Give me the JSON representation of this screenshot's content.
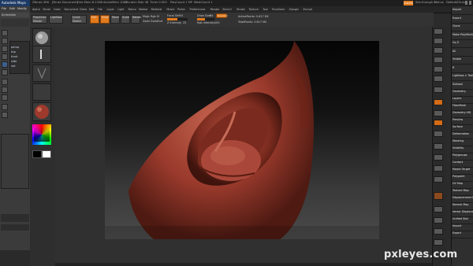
{
  "maya": {
    "title": "Autodesk Maya",
    "menus": [
      "File",
      "Edit",
      "Modify"
    ],
    "mode": "Animation",
    "outliner_items": [
      "persp",
      "top",
      "front",
      "side",
      "set"
    ]
  },
  "zbrush": {
    "title_segments": [
      "ZBrush 4R6",
      "[Brush Document]",
      "Free Mem 8.13GB",
      "ActiveMem 1086",
      "Scratch Disk 48",
      "Timer 0.003",
      "PolyCount 1 MP",
      "MeshCount 1"
    ],
    "menus": [
      "Alpha",
      "Brush",
      "Color",
      "Document",
      "Draw",
      "Edit",
      "File",
      "Layer",
      "Light",
      "Macro",
      "Marker",
      "Material",
      "Movie",
      "Picker",
      "Preferences",
      "Render",
      "Stencil",
      "Stroke",
      "Texture",
      "Tool",
      "Transform",
      "Zplugin",
      "Zscript"
    ],
    "quick_buttons": [
      "QuickSave",
      "See-through 0",
      "Menus",
      "DefaultZScript"
    ],
    "toolbar": {
      "projection_master": "Projection Master",
      "lightbox": "LightBox",
      "quick_sketch": "Quick Sketch",
      "edit": "Edit",
      "draw": "Draw",
      "move": "Move",
      "scale": "Scale",
      "rotate": "Rotate",
      "mrgb": "Mrgb",
      "rgb": "Rgb",
      "m": "M",
      "zadd": "Zadd",
      "zsub": "Zsub",
      "zcut": "Zcut",
      "focal_shift_label": "Focal Shift",
      "focal_shift_value": "0",
      "draw_size_label": "Draw Size",
      "draw_size_value": "64",
      "dynamic": "Dynamic",
      "z_intensity_label": "Z Intensity",
      "z_intensity_value": "25",
      "rgb_intensity_label": "Rgb Intensity",
      "rgb_intensity_value": "100",
      "active_points": "ActivePoints: 0.617 Mil",
      "total_points": "TotalPoints: 0.617 Mil"
    },
    "right_tray": [
      "Import",
      "Export",
      "Clone",
      "Make PolyMesh3D",
      "Go Z",
      "All",
      "Visible",
      "R",
      "Lightbox > Tools",
      "Subtool",
      "Geometry",
      "Layers",
      "FiberMesh",
      "Geometry HD",
      "Preview",
      "Surface",
      "Deformation",
      "Masking",
      "Visibility",
      "Polygroups",
      "Contact",
      "Morph Target",
      "Polypaint",
      "UV Map",
      "Texture Map",
      "Displacement Map",
      "Normal Map",
      "Vector Displacement",
      "Unified Skin",
      "Import",
      "Export"
    ],
    "highlight_color": "#e27a1c",
    "viewport_mesh_color": "#9a3a2c"
  },
  "watermark": "pxleyes.com"
}
